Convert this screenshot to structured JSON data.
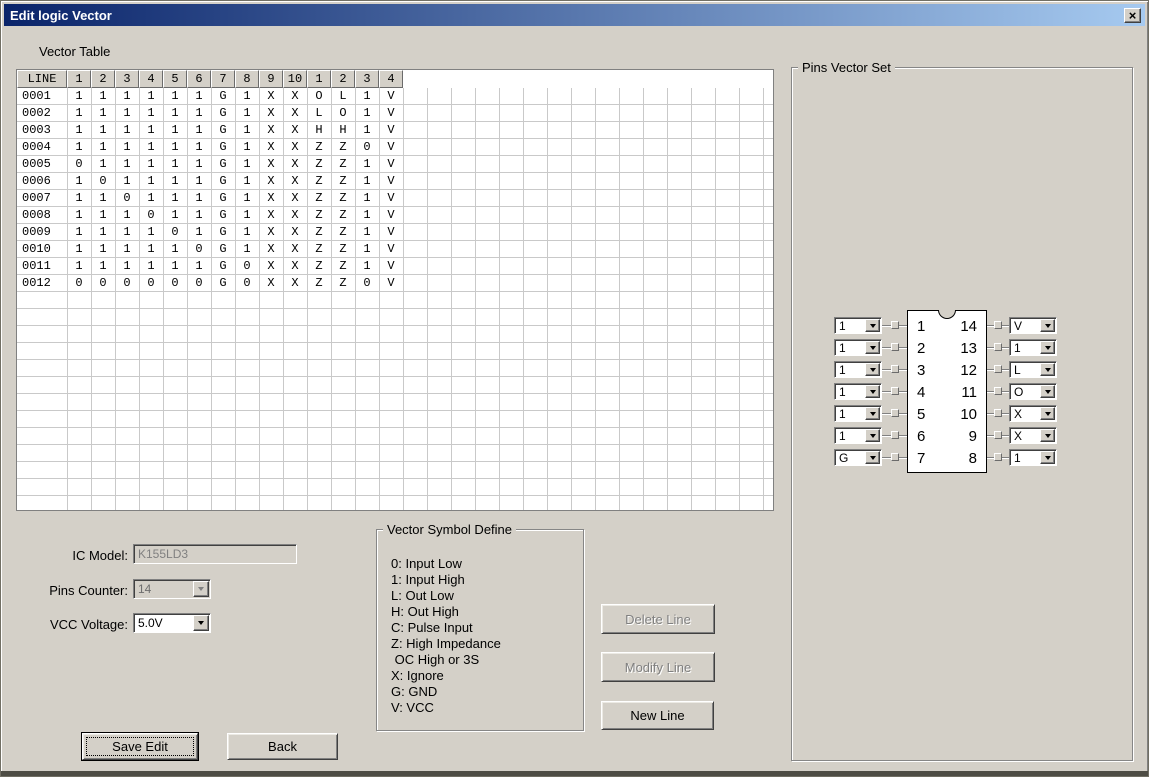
{
  "window": {
    "title": "Edit logic Vector",
    "close_glyph": "×"
  },
  "vector_table": {
    "label": "Vector Table",
    "headers": [
      "LINE",
      "1",
      "2",
      "3",
      "4",
      "5",
      "6",
      "7",
      "8",
      "9",
      "10",
      "1",
      "2",
      "3",
      "4"
    ],
    "rows": [
      {
        "line": "0001",
        "values": [
          "1",
          "1",
          "1",
          "1",
          "1",
          "1",
          "G",
          "1",
          "X",
          "X",
          "O",
          "L",
          "1",
          "V"
        ]
      },
      {
        "line": "0002",
        "values": [
          "1",
          "1",
          "1",
          "1",
          "1",
          "1",
          "G",
          "1",
          "X",
          "X",
          "L",
          "O",
          "1",
          "V"
        ]
      },
      {
        "line": "0003",
        "values": [
          "1",
          "1",
          "1",
          "1",
          "1",
          "1",
          "G",
          "1",
          "X",
          "X",
          "H",
          "H",
          "1",
          "V"
        ]
      },
      {
        "line": "0004",
        "values": [
          "1",
          "1",
          "1",
          "1",
          "1",
          "1",
          "G",
          "1",
          "X",
          "X",
          "Z",
          "Z",
          "0",
          "V"
        ]
      },
      {
        "line": "0005",
        "values": [
          "0",
          "1",
          "1",
          "1",
          "1",
          "1",
          "G",
          "1",
          "X",
          "X",
          "Z",
          "Z",
          "1",
          "V"
        ]
      },
      {
        "line": "0006",
        "values": [
          "1",
          "0",
          "1",
          "1",
          "1",
          "1",
          "G",
          "1",
          "X",
          "X",
          "Z",
          "Z",
          "1",
          "V"
        ]
      },
      {
        "line": "0007",
        "values": [
          "1",
          "1",
          "0",
          "1",
          "1",
          "1",
          "G",
          "1",
          "X",
          "X",
          "Z",
          "Z",
          "1",
          "V"
        ]
      },
      {
        "line": "0008",
        "values": [
          "1",
          "1",
          "1",
          "0",
          "1",
          "1",
          "G",
          "1",
          "X",
          "X",
          "Z",
          "Z",
          "1",
          "V"
        ]
      },
      {
        "line": "0009",
        "values": [
          "1",
          "1",
          "1",
          "1",
          "0",
          "1",
          "G",
          "1",
          "X",
          "X",
          "Z",
          "Z",
          "1",
          "V"
        ]
      },
      {
        "line": "0010",
        "values": [
          "1",
          "1",
          "1",
          "1",
          "1",
          "0",
          "G",
          "1",
          "X",
          "X",
          "Z",
          "Z",
          "1",
          "V"
        ]
      },
      {
        "line": "0011",
        "values": [
          "1",
          "1",
          "1",
          "1",
          "1",
          "1",
          "G",
          "0",
          "X",
          "X",
          "Z",
          "Z",
          "1",
          "V"
        ]
      },
      {
        "line": "0012",
        "values": [
          "0",
          "0",
          "0",
          "0",
          "0",
          "0",
          "G",
          "0",
          "X",
          "X",
          "Z",
          "Z",
          "0",
          "V"
        ]
      }
    ]
  },
  "pins_vector_set": {
    "label": "Pins Vector Set",
    "left_pins": [
      {
        "pin": "1",
        "value": "1"
      },
      {
        "pin": "2",
        "value": "1"
      },
      {
        "pin": "3",
        "value": "1"
      },
      {
        "pin": "4",
        "value": "1"
      },
      {
        "pin": "5",
        "value": "1"
      },
      {
        "pin": "6",
        "value": "1"
      },
      {
        "pin": "7",
        "value": "G"
      }
    ],
    "right_pins": [
      {
        "pin": "14",
        "value": "V"
      },
      {
        "pin": "13",
        "value": "1"
      },
      {
        "pin": "12",
        "value": "L"
      },
      {
        "pin": "11",
        "value": "O"
      },
      {
        "pin": "10",
        "value": "X"
      },
      {
        "pin": "9",
        "value": "X"
      },
      {
        "pin": "8",
        "value": "1"
      }
    ]
  },
  "controls": {
    "ic_model_label": "IC Model:",
    "ic_model_value": "K155LD3",
    "pins_counter_label": "Pins Counter:",
    "pins_counter_value": "14",
    "vcc_voltage_label": "VCC Voltage:",
    "vcc_voltage_value": "5.0V"
  },
  "symbol_define": {
    "label": "Vector Symbol Define",
    "lines": [
      "0: Input Low",
      "1: Input High",
      "L: Out Low",
      "H: Out High",
      "C: Pulse Input",
      "Z: High Impedance",
      " OC High or 3S",
      "X: Ignore",
      "G: GND",
      "V: VCC"
    ]
  },
  "actions": {
    "delete_line": "Delete Line",
    "modify_line": "Modify Line",
    "new_line": "New Line",
    "save_edit": "Save Edit",
    "back": "Back"
  },
  "colors": {
    "window_bg": "#d4d0c8",
    "titlebar_start": "#0a246a",
    "titlebar_end": "#a6caf0",
    "grid_line": "#c9c9c9",
    "disabled_text": "#808080"
  }
}
